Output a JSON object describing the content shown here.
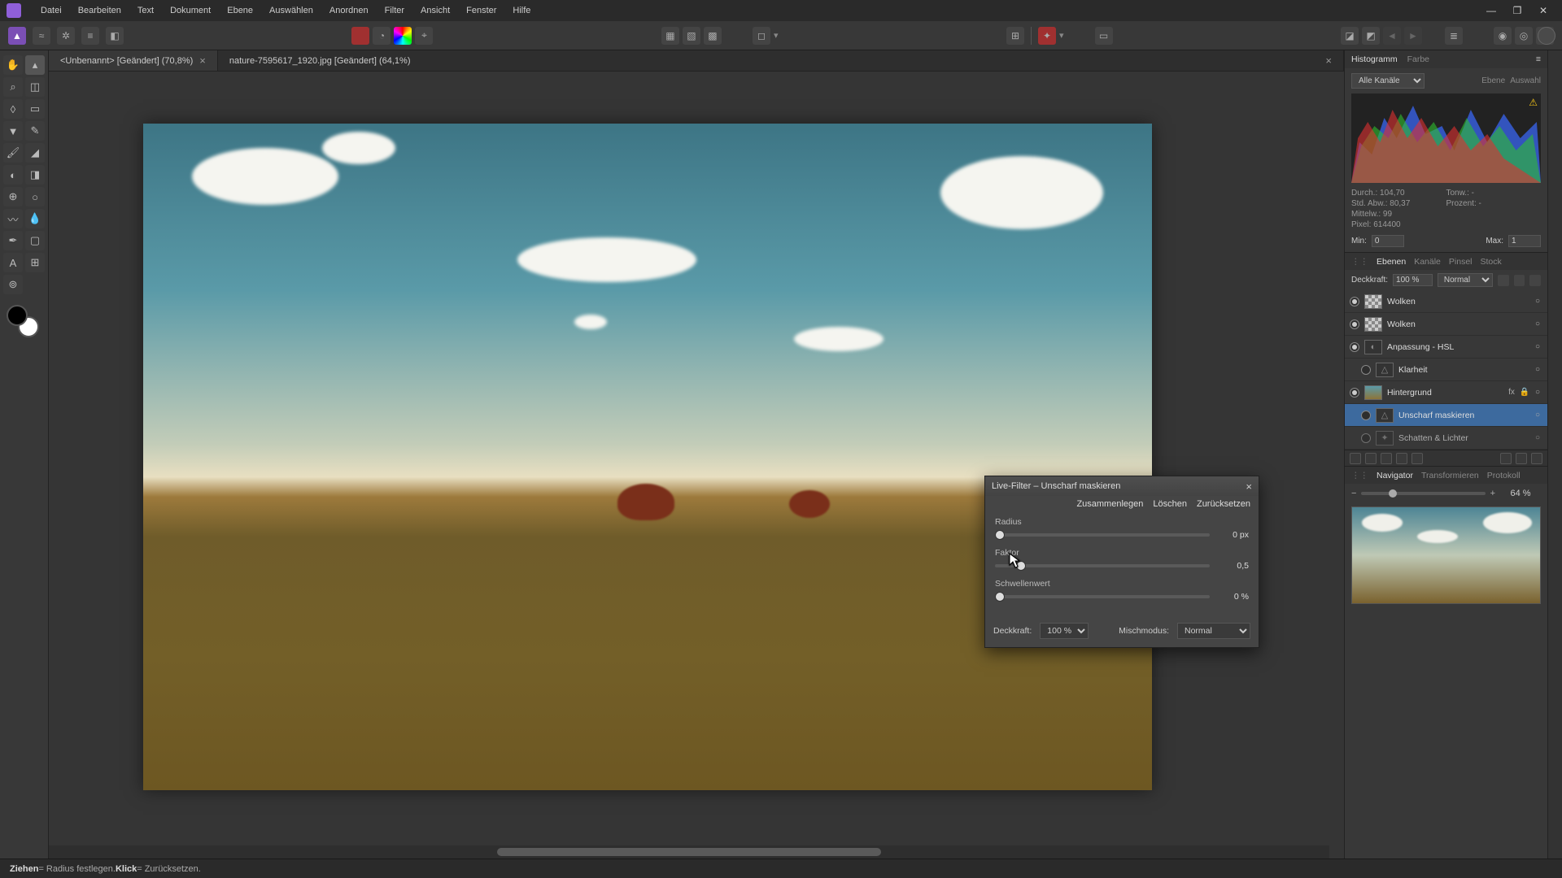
{
  "menu": [
    "Datei",
    "Bearbeiten",
    "Text",
    "Dokument",
    "Ebene",
    "Auswählen",
    "Anordnen",
    "Filter",
    "Ansicht",
    "Fenster",
    "Hilfe"
  ],
  "tabs": [
    {
      "label": "<Unbenannt> [Geändert] (70,8%)",
      "active": false
    },
    {
      "label": "nature-7595617_1920.jpg [Geändert] (64,1%)",
      "active": true
    }
  ],
  "histogram": {
    "tab_hist": "Histogramm",
    "tab_color": "Farbe",
    "channel": "Alle Kanäle",
    "btn_layer": "Ebene",
    "btn_sel": "Auswahl",
    "stats": {
      "durch": "Durch.: 104,70",
      "std": "Std. Abw.: 80,37",
      "mittel": "Mittelw.: 99",
      "pixel": "Pixel: 614400",
      "tonw": "Tonw.: -",
      "proz": "Prozent: -"
    },
    "min_label": "Min:",
    "min_val": "0",
    "max_label": "Max:",
    "max_val": "1"
  },
  "layers_panel": {
    "tabs": [
      "Ebenen",
      "Kanäle",
      "Pinsel",
      "Stock"
    ],
    "opacity_label": "Deckkraft:",
    "opacity": "100 %",
    "blend": "Normal",
    "layers": [
      {
        "name": "Wolken",
        "thumb": "check",
        "vis": true
      },
      {
        "name": "Wolken",
        "thumb": "check",
        "vis": true
      },
      {
        "name": "Anpassung - HSL",
        "thumb": "adj",
        "icon": "◐",
        "vis": true
      },
      {
        "name": "Klarheit",
        "thumb": "adj",
        "icon": "△",
        "vis": false,
        "indent": true
      },
      {
        "name": "Hintergrund",
        "thumb": "img",
        "vis": true,
        "fx": true,
        "lock": true
      },
      {
        "name": "Unscharf maskieren",
        "thumb": "adj",
        "icon": "△",
        "sel": true,
        "indent": true
      },
      {
        "name": "Schatten & Lichter",
        "thumb": "adj",
        "icon": "✦",
        "indent": true,
        "cut": true
      }
    ]
  },
  "navigator": {
    "tabs": [
      "Navigator",
      "Transformieren",
      "Protokoll"
    ],
    "zoom": "64 %"
  },
  "dialog": {
    "title": "Live-Filter – Unscharf maskieren",
    "actions": [
      "Zusammenlegen",
      "Löschen",
      "Zurücksetzen"
    ],
    "sliders": [
      {
        "label": "Radius",
        "value": "0 px",
        "pos": 0
      },
      {
        "label": "Faktor",
        "value": "0,5",
        "pos": 10
      },
      {
        "label": "Schwellenwert",
        "value": "0 %",
        "pos": 0
      }
    ],
    "opacity_label": "Deckkraft:",
    "opacity": "100 %",
    "blend_label": "Mischmodus:",
    "blend": "Normal"
  },
  "status": {
    "drag": "Ziehen",
    "drag_txt": " = Radius festlegen. ",
    "click": "Klick",
    "click_txt": " = Zurücksetzen."
  }
}
